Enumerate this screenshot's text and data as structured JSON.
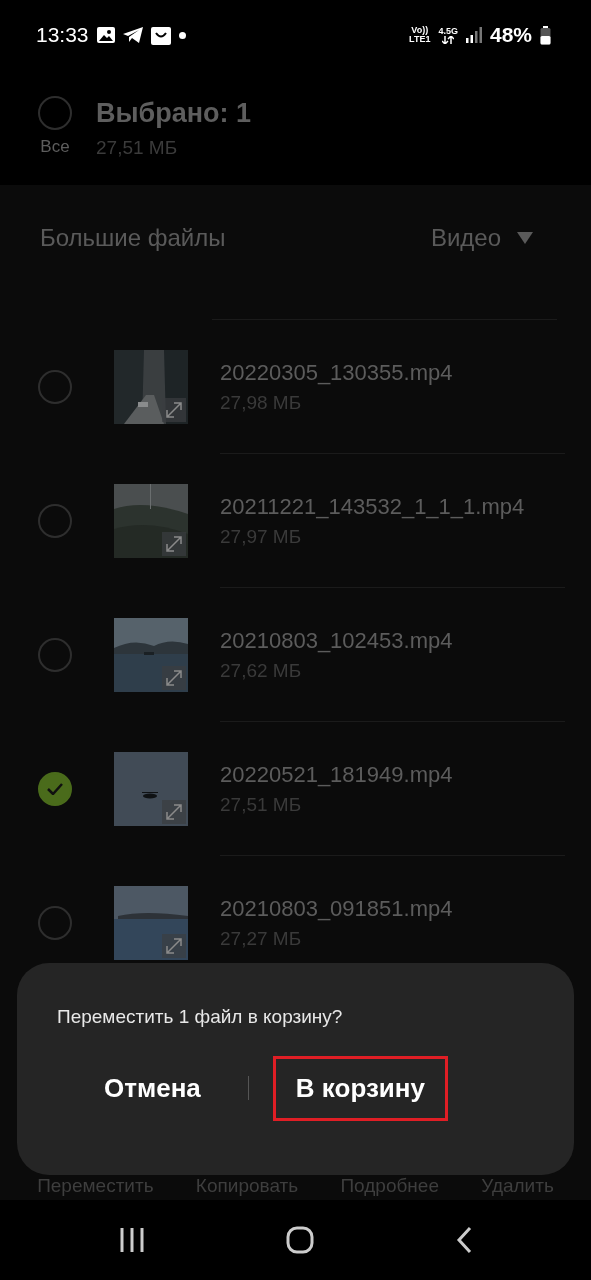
{
  "status_bar": {
    "time": "13:33",
    "network_top": "Vo))",
    "network_bottom": "LTE1",
    "data_type": "4.5G",
    "battery": "48%"
  },
  "header": {
    "select_all_label": "Все",
    "select_all_checked": false,
    "title": "Выбрано: 1",
    "subtitle": "27,51 МБ"
  },
  "section": {
    "title": "Большие файлы",
    "filter": "Видео"
  },
  "files": [
    {
      "name": "20220305_130355.mp4",
      "size": "27,98 МБ",
      "selected": false
    },
    {
      "name": "20211221_143532_1_1_1.mp4",
      "size": "27,97 МБ",
      "selected": false
    },
    {
      "name": "20210803_102453.mp4",
      "size": "27,62 МБ",
      "selected": false
    },
    {
      "name": "20220521_181949.mp4",
      "size": "27,51 МБ",
      "selected": true
    },
    {
      "name": "20210803_091851.mp4",
      "size": "27,27 МБ",
      "selected": false
    }
  ],
  "bottom_actions": [
    "Переместить",
    "Копировать",
    "Подробнее",
    "Удалить"
  ],
  "dialog": {
    "message": "Переместить 1 файл в корзину?",
    "buttons": [
      {
        "label": "Отмена",
        "highlighted": false
      },
      {
        "label": "В корзину",
        "highlighted": true
      }
    ]
  }
}
